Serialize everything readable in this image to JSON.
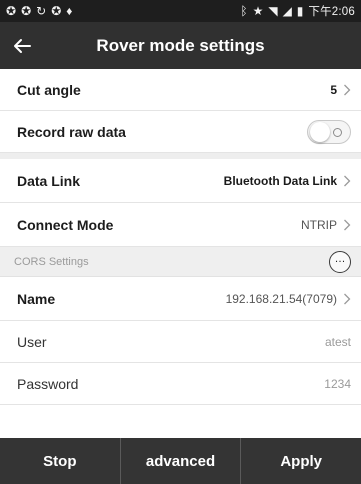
{
  "status_bar": {
    "left_icons": [
      "notification-icon",
      "notification-icon",
      "sync-icon",
      "notification-icon",
      "location-pin-icon"
    ],
    "right_icons": [
      "bluetooth-icon",
      "star-icon",
      "wifi-icon",
      "signal-icon",
      "battery-icon"
    ],
    "time": "下午2:06"
  },
  "header": {
    "title": "Rover mode settings",
    "back_icon": "arrow-left-icon"
  },
  "settings": {
    "cut_angle": {
      "label": "Cut angle",
      "value": "5"
    },
    "record_raw_data": {
      "label": "Record raw data",
      "enabled": false
    },
    "data_link": {
      "label": "Data Link",
      "value": "Bluetooth Data Link"
    },
    "connect_mode": {
      "label": "Connect Mode",
      "value": "NTRIP"
    }
  },
  "cors_section": {
    "title": "CORS Settings",
    "more_icon": "more-horizontal-icon",
    "name": {
      "label": "Name",
      "value": "192.168.21.54(7079)"
    },
    "user": {
      "label": "User",
      "value": "atest"
    },
    "password": {
      "label": "Password",
      "value": "1234"
    }
  },
  "bottom_bar": {
    "stop_label": "Stop",
    "advanced_label": "advanced",
    "apply_label": "Apply"
  },
  "colors": {
    "status_bar_bg": "#1e1e1e",
    "header_bg": "#303030",
    "bottom_bar_bg": "#343434",
    "section_bg": "#efefef"
  }
}
